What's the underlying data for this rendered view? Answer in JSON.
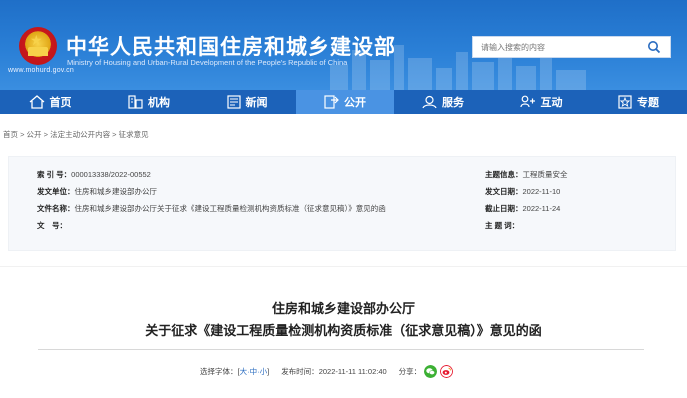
{
  "header": {
    "title_cn": "中华人民共和国住房和城乡建设部",
    "title_en": "Ministry of Housing and Urban-Rural Development of the People's Republic of China",
    "site_url": "www.mohurd.gov.cn",
    "search_placeholder": "请输入搜索的内容"
  },
  "nav": [
    {
      "label": "首页",
      "icon": "home-icon"
    },
    {
      "label": "机构",
      "icon": "building-icon"
    },
    {
      "label": "新闻",
      "icon": "news-icon"
    },
    {
      "label": "公开",
      "icon": "open-icon",
      "active": true
    },
    {
      "label": "服务",
      "icon": "service-icon"
    },
    {
      "label": "互动",
      "icon": "interact-icon"
    },
    {
      "label": "专题",
      "icon": "topic-icon"
    }
  ],
  "breadcrumb": "首页 > 公开 > 法定主动公开内容 > 征求意见",
  "meta": {
    "index_label": "索 引 号：",
    "index_value": "000013338/2022-00552",
    "unit_label": "发文单位：",
    "unit_value": "住房和城乡建设部办公厅",
    "name_label": "文件名称：",
    "name_value": "住房和城乡建设部办公厅关于征求《建设工程质量检测机构资质标准（征求意见稿）》意见的函",
    "docno_label": "文　号：",
    "docno_value": "",
    "topic_label": "主题信息：",
    "topic_value": "工程质量安全",
    "date_label": "发文日期：",
    "date_value": "2022-11-10",
    "deadline_label": "截止日期：",
    "deadline_value": "2022-11-24",
    "keywords_label": "主 题 词：",
    "keywords_value": ""
  },
  "doc": {
    "title_line1": "住房和城乡建设部办公厅",
    "title_line2": "关于征求《建设工程质量检测机构资质标准（征求意见稿）》意见的函"
  },
  "tools": {
    "font_label": "选择字体：[",
    "font_large": "大",
    "font_mid": "中",
    "font_small": "小",
    "font_end": "]",
    "publish_label": "发布时间：",
    "publish_value": "2022-11-11 11:02:40",
    "share_label": "分享："
  },
  "colors": {
    "header_blue": "#2a7fd6",
    "nav_blue": "#1c62b9",
    "nav_active": "#4a93e3",
    "wechat_green": "#3cb034",
    "weibo_red": "#e6162d"
  }
}
